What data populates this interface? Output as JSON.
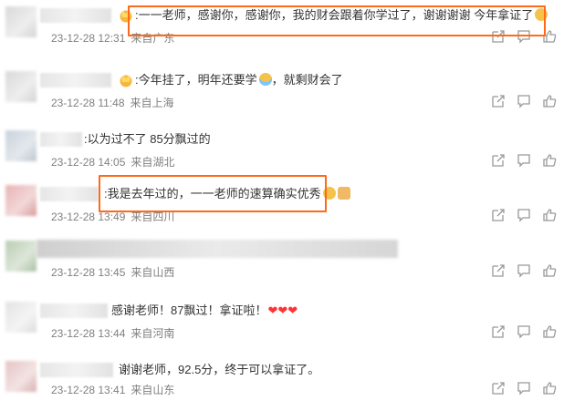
{
  "comments": [
    {
      "text": ":一一老师，感谢你，感谢你，我的财会跟着你学过了，谢谢谢谢 今年拿证了",
      "date": "23-12-28 12:31",
      "location": "来自广东",
      "crown": true,
      "emoji": "wave-emoji"
    },
    {
      "text": ":今年挂了，明年还要学",
      "text2": "，就剩财会了",
      "date": "23-12-28 11:48",
      "location": "来自上海",
      "crown": true,
      "emoji": "cry-emoji"
    },
    {
      "text": ":以为过不了 85分飘过的",
      "date": "23-12-28 14:05",
      "location": "来自湖北"
    },
    {
      "text": ":我是去年过的，一一老师的速算确实优秀",
      "date": "23-12-28 13:49",
      "location": "来自四川",
      "emoji": "smile-emoji"
    },
    {
      "text": "",
      "date": "23-12-28 13:45",
      "location": "来自山西"
    },
    {
      "text": "感谢老师！87飘过！拿证啦！",
      "date": "23-12-28 13:44",
      "location": "来自河南",
      "hearts": "❤❤❤"
    },
    {
      "text": "谢谢老师，92.5分，终于可以拿证了。",
      "date": "23-12-28 13:41",
      "location": "来自山东"
    }
  ],
  "colors": {
    "highlight": "#ff6a1a",
    "meta_text": "#808080",
    "body_text": "#333333"
  },
  "icons": [
    "share-icon",
    "comment-icon",
    "like-icon"
  ]
}
